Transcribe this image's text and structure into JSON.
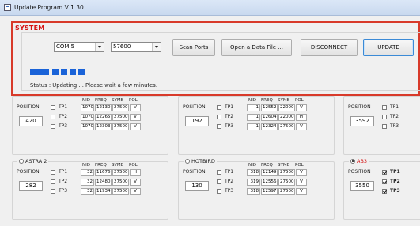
{
  "window": {
    "title": "Update Program V 1.30"
  },
  "system": {
    "title": "SYSTEM",
    "port": "COM 5",
    "baud": "57600",
    "buttons": {
      "scan": "Scan Ports",
      "open": "Open a Data File ...",
      "disconnect": "DISCONNECT",
      "update": "UPDATE"
    },
    "progress_segments_filled": 5,
    "status_label": "Status :",
    "status_text": "Updating ...  Please wait a few minutes."
  },
  "labels": {
    "position": "POSITION",
    "tp1": "TP1",
    "tp2": "TP2",
    "tp3": "TP3",
    "nid": "NID",
    "freq": "FREQ",
    "symb": "SYMB",
    "pol": "POL"
  },
  "satellites": [
    {
      "name": "",
      "position": "420",
      "tp_checked": [
        false,
        false,
        false
      ],
      "rows": [
        {
          "nid": "1070",
          "freq": "12130",
          "symb": "27500",
          "pol": "V"
        },
        {
          "nid": "1070",
          "freq": "12265",
          "symb": "27500",
          "pol": "V"
        },
        {
          "nid": "1070",
          "freq": "12303",
          "symb": "27500",
          "pol": "V"
        }
      ]
    },
    {
      "name": "",
      "position": "192",
      "tp_checked": [
        false,
        false,
        false
      ],
      "rows": [
        {
          "nid": "1",
          "freq": "12552",
          "symb": "22000",
          "pol": "V"
        },
        {
          "nid": "1",
          "freq": "12604",
          "symb": "22000",
          "pol": "H"
        },
        {
          "nid": "1",
          "freq": "12324",
          "symb": "27500",
          "pol": "V"
        }
      ]
    },
    {
      "name": "",
      "position": "3592",
      "tp_checked": [
        false,
        false,
        false
      ],
      "rows": []
    },
    {
      "name": "ASTRA 2",
      "position": "282",
      "tp_checked": [
        false,
        false,
        false
      ],
      "rows": [
        {
          "nid": "32",
          "freq": "11676",
          "symb": "27500",
          "pol": "H"
        },
        {
          "nid": "32",
          "freq": "12480",
          "symb": "27500",
          "pol": "V"
        },
        {
          "nid": "32",
          "freq": "11934",
          "symb": "27500",
          "pol": "V"
        }
      ]
    },
    {
      "name": "HOTBIRD",
      "position": "130",
      "tp_checked": [
        false,
        false,
        false
      ],
      "rows": [
        {
          "nid": "318",
          "freq": "12149",
          "symb": "27500",
          "pol": "V"
        },
        {
          "nid": "319",
          "freq": "12556",
          "symb": "27500",
          "pol": "V"
        },
        {
          "nid": "318",
          "freq": "12597",
          "symb": "27500",
          "pol": "V"
        }
      ]
    },
    {
      "name": "AB3",
      "position": "3550",
      "tp_checked": [
        true,
        true,
        true
      ],
      "rows": []
    }
  ],
  "colors": {
    "system_border": "#d83a2a",
    "system_title": "#d41111",
    "progress": "#1a63d8",
    "focus": "#3b8ad6"
  }
}
